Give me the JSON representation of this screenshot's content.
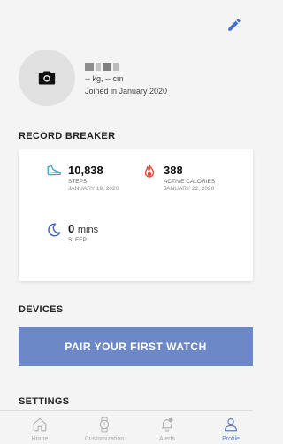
{
  "profile": {
    "stats": "-- kg, -- cm",
    "joined": "Joined in January 2020"
  },
  "sections": {
    "record_breaker": "RECORD BREAKER",
    "devices": "DEVICES",
    "settings": "SETTINGS"
  },
  "records": [
    {
      "value": "10,838",
      "unit": "",
      "label": "STEPS",
      "date": "JANUARY 19, 2020",
      "icon": "shoe-icon",
      "color": "#3a9fd6"
    },
    {
      "value": "388",
      "unit": "",
      "label": "ACTIVE CALORIES",
      "date": "JANUARY 22, 2020",
      "icon": "flame-icon",
      "color": "#e8483c"
    },
    {
      "value": "0",
      "unit": "mins",
      "label": "SLEEP",
      "date": "",
      "icon": "moon-icon",
      "color": "#3f5fb8"
    }
  ],
  "devices": {
    "pair_label": "PAIR YOUR FIRST WATCH",
    "button_color": "#6d88c6"
  },
  "tabs": [
    {
      "label": "Home",
      "icon": "home-icon",
      "active": false
    },
    {
      "label": "Customization",
      "icon": "watch-icon",
      "active": false
    },
    {
      "label": "Alerts",
      "icon": "bell-icon",
      "active": false
    },
    {
      "label": "Profile",
      "icon": "person-icon",
      "active": true
    }
  ],
  "colors": {
    "accent": "#5c7fd0",
    "edit_icon": "#4a6fc9"
  }
}
